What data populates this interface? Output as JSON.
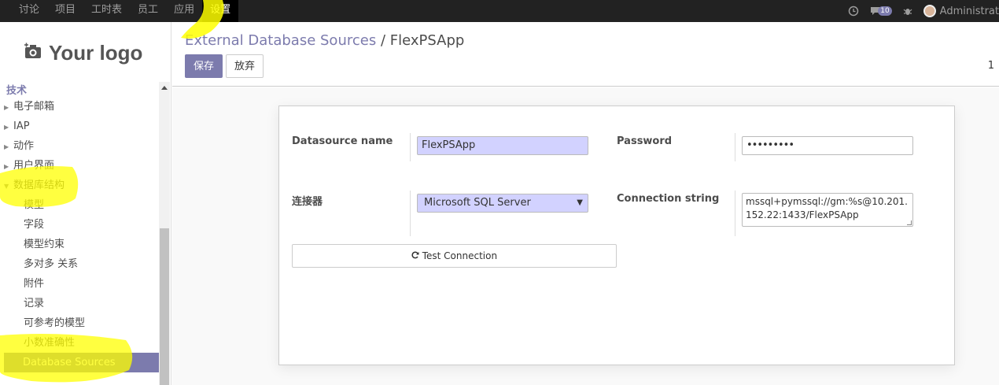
{
  "topbar": {
    "menu": [
      "讨论",
      "项目",
      "工时表",
      "员工",
      "应用",
      "设置"
    ],
    "active_index": 5,
    "notification_count": "10",
    "user_name": "Administrat"
  },
  "sidebar": {
    "logo_text": "Your logo",
    "section_title": "技术",
    "level1": [
      "电子邮箱",
      "IAP",
      "动作",
      "用户界面",
      "数据库结构"
    ],
    "level2": [
      "模型",
      "字段",
      "模型约束",
      "多对多 关系",
      "附件",
      "记录",
      "可参考的模型",
      "小数准确性"
    ],
    "selected": "Database Sources"
  },
  "control_panel": {
    "breadcrumb_parent": "External Database Sources",
    "breadcrumb_sep": "/",
    "breadcrumb_current": "FlexPSApp",
    "save_label": "保存",
    "discard_label": "放弃",
    "pager": "1"
  },
  "form": {
    "datasource_label": "Datasource name",
    "datasource_value": "FlexPSApp",
    "password_label": "Password",
    "password_value": "•••••••••",
    "connector_label": "连接器",
    "connector_value": "Microsoft SQL Server",
    "conn_string_label": "Connection string",
    "conn_string_value": "mssql+pymssql://gm:%s@10.201.152.22:1433/FlexPSApp",
    "test_label": "Test Connection"
  },
  "colors": {
    "brand": "#7c7bad",
    "required_field": "#d2d2ff",
    "highlight": "#ffff00"
  }
}
